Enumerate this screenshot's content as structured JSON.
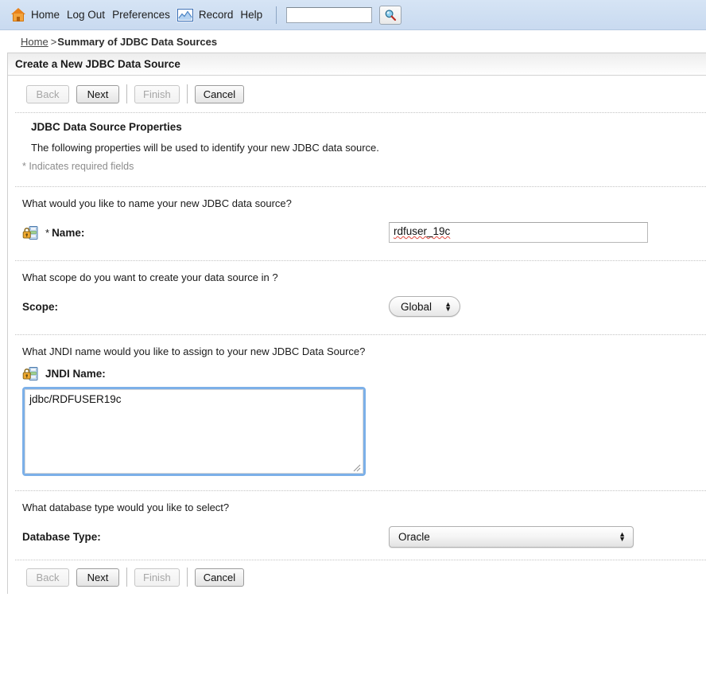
{
  "topnav": {
    "home_icon": "home-icon",
    "links": [
      {
        "label": "Home",
        "name": "nav-home"
      },
      {
        "label": "Log Out",
        "name": "nav-logout"
      },
      {
        "label": "Preferences",
        "name": "nav-preferences"
      }
    ],
    "record_icon": "record-chart-icon",
    "links_after": [
      {
        "label": "Record",
        "name": "nav-record"
      },
      {
        "label": "Help",
        "name": "nav-help"
      }
    ],
    "search": {
      "value": "",
      "placeholder": ""
    },
    "search_icon": "magnifier-icon"
  },
  "breadcrumb": {
    "home": "Home",
    "separator": ">",
    "current": "Summary of JDBC Data Sources"
  },
  "page": {
    "title": "Create a New JDBC Data Source"
  },
  "toolbar": {
    "back": "Back",
    "next": "Next",
    "finish": "Finish",
    "cancel": "Cancel",
    "back_enabled": false,
    "next_enabled": true,
    "finish_enabled": false,
    "cancel_enabled": true
  },
  "section": {
    "heading": "JDBC Data Source Properties",
    "description": "The following properties will be used to identify your new JDBC data source.",
    "required_note": "* Indicates required fields"
  },
  "fields": {
    "name": {
      "question": "What would you like to name your new JDBC data source?",
      "label": "Name:",
      "required_marker": "*",
      "value": "rdfuser_19c",
      "icon": "config-lock-icon"
    },
    "scope": {
      "question": "What scope do you want to create your data source in ?",
      "label": "Scope:",
      "value": "Global",
      "options": [
        "Global"
      ]
    },
    "jndi": {
      "question": "What JNDI name would you like to assign to your new JDBC Data Source?",
      "label": "JNDI Name:",
      "value": "jdbc/RDFUSER19c",
      "icon": "config-lock-icon"
    },
    "database_type": {
      "question": "What database type would you like to select?",
      "label": "Database Type:",
      "value": "Oracle",
      "options": [
        "Oracle"
      ]
    }
  },
  "colors": {
    "topbar": "#cfdff2",
    "focus_ring": "#7cb0e8",
    "home_orange": "#e8821a",
    "spellcheck_red": "#e04a3f"
  }
}
